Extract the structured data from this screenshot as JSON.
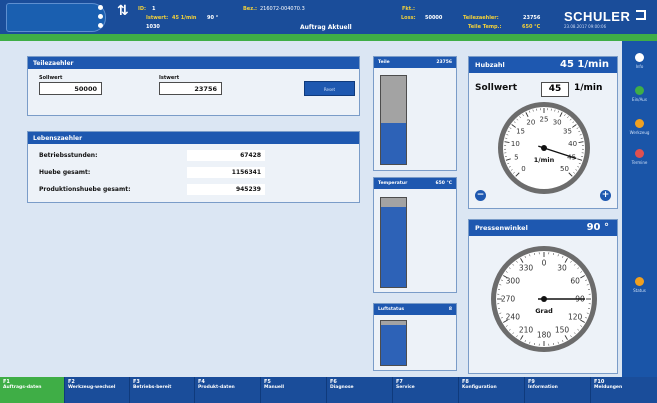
{
  "header": {
    "id_label": "ID:",
    "id_value": "1",
    "istwert_label": "Istwert:",
    "istwert_value": "45 1/min",
    "istwert_extra": "90 °",
    "bez_label": "Bez.:",
    "bez_value": "216072-004070.3",
    "row3_value": "1030",
    "fkt_label": "Fkt.:",
    "loss_label": "Loss:",
    "loss_value": "50000",
    "teilezaehler_label": "Teilezaehler:",
    "teilezaehler_value": "23756",
    "temp_label": "Teile Temp.:",
    "temp_value": "650 °C",
    "title": "Auftrag Aktuell",
    "logo": "SCHULER",
    "datetime": "23.08.2017 09:00:06"
  },
  "teilezaehler": {
    "title": "Teilezaehler",
    "sollwert_label": "Sollwert",
    "sollwert_value": "50000",
    "istwert_label": "Istwert",
    "istwert_value": "23756",
    "button_label": "Reset"
  },
  "lebenszaehler": {
    "title": "Lebenszaehler",
    "rows": [
      {
        "label": "Betriebsstunden:",
        "value": "67428"
      },
      {
        "label": "Huebe gesamt:",
        "value": "1156341"
      },
      {
        "label": "Produktionshuebe gesamt:",
        "value": "945239"
      }
    ]
  },
  "bars": [
    {
      "label": "Teile",
      "value": "23756",
      "fill": 0.47,
      "gray": 0.53
    },
    {
      "label": "Temperatur",
      "value": "650 °C",
      "fill": 0.9,
      "gray": 0.1
    },
    {
      "label": "Luftstatus",
      "value": "8",
      "fill": 0.9,
      "gray": 0.1
    }
  ],
  "hubzahl": {
    "title": "Hubzahl",
    "value": "45 1/min",
    "sollwert_label": "Sollwert",
    "sollwert_value": "45",
    "sollwert_unit": "1/min",
    "gauge_unit": "1/min",
    "ticks": [
      "0",
      "5",
      "10",
      "15",
      "20",
      "25",
      "30",
      "35",
      "40",
      "45",
      "50"
    ],
    "needle_value": 45,
    "minus_label": "−",
    "plus_label": "+"
  },
  "pressenwinkel": {
    "title": "Pressenwinkel",
    "value": "90 °",
    "gauge_unit": "Grad",
    "ticks": [
      "0",
      "30",
      "60",
      "90",
      "120",
      "150",
      "180",
      "210",
      "240",
      "270",
      "300",
      "330"
    ],
    "needle_value": 90
  },
  "sidebar": [
    {
      "icon": "home-icon",
      "label": "Info",
      "color": "#ffffff"
    },
    {
      "icon": "add-icon",
      "label": "Ein/Aus",
      "color": "#3fae46"
    },
    {
      "icon": "wrench-icon",
      "label": "Werkzeug",
      "color": "#f0a020"
    },
    {
      "icon": "calendar-icon",
      "label": "Termine",
      "color": "#e05050"
    },
    {
      "icon": "chart-icon",
      "label": "Status",
      "color": "#f0a020"
    }
  ],
  "fkeys": [
    {
      "key": "F1",
      "label": "Auftrags-daten",
      "active": true
    },
    {
      "key": "F2",
      "label": "Werkzeug-wechsel",
      "active": false
    },
    {
      "key": "F3",
      "label": "Betriebs-bereit",
      "active": false
    },
    {
      "key": "F4",
      "label": "Produkt-daten",
      "active": false
    },
    {
      "key": "F5",
      "label": "Manuell",
      "active": false
    },
    {
      "key": "F6",
      "label": "Diagnose",
      "active": false
    },
    {
      "key": "F7",
      "label": "Service",
      "active": false
    },
    {
      "key": "F8",
      "label": "Konfiguration",
      "active": false
    },
    {
      "key": "F9",
      "label": "Information",
      "active": false
    },
    {
      "key": "F10",
      "label": "Meldungen",
      "active": false
    }
  ]
}
